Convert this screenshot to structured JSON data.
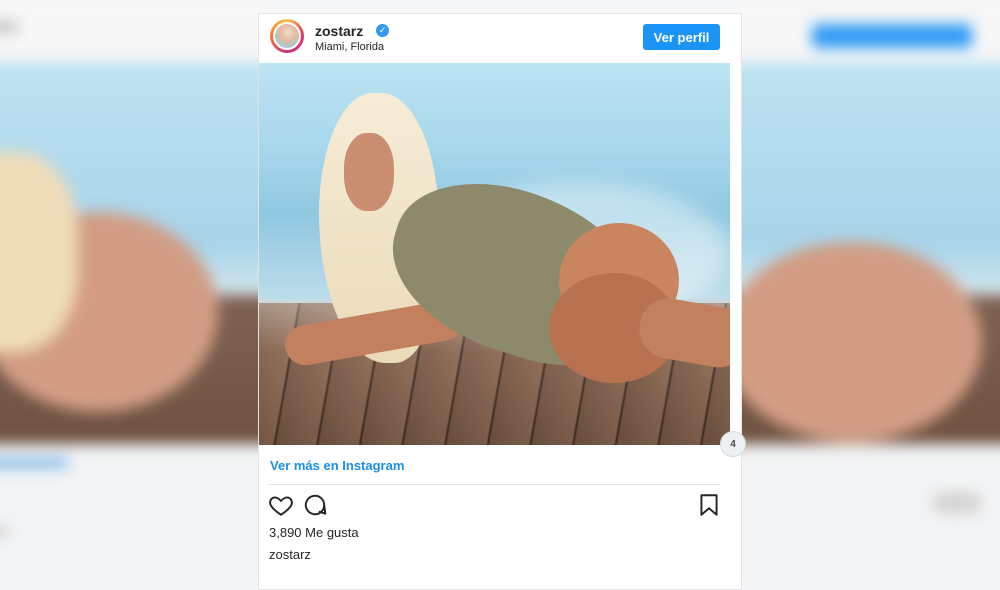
{
  "post": {
    "username": "zostarz",
    "location": "Miami, Florida",
    "verified_glyph": "✓",
    "follow_label": "Ver perfil",
    "more_link": "Ver más en Instagram",
    "likes": "3,890 Me gusta",
    "caption_user": "zostarz",
    "carousel_badge": "4"
  },
  "icons": {
    "like": "heart-icon",
    "comment": "comment-icon",
    "save": "bookmark-icon",
    "verified": "verified-badge-icon"
  },
  "colors": {
    "accent": "#1a94f5",
    "link": "#1a8fe8",
    "text": "#262626"
  }
}
